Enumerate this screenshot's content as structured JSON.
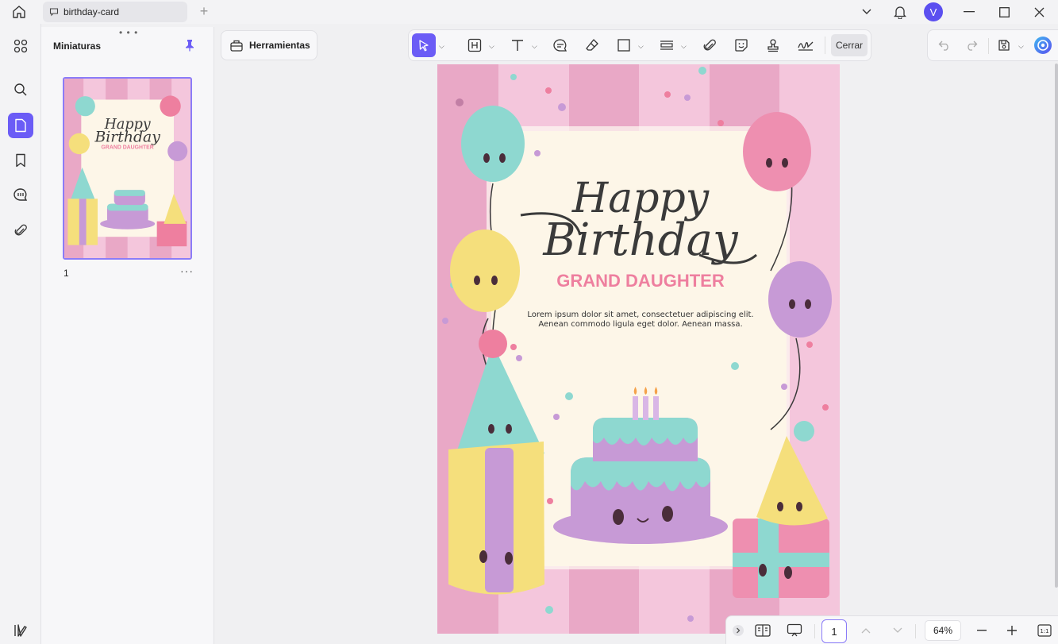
{
  "tab": {
    "title": "birthday-card"
  },
  "user": {
    "initial": "V"
  },
  "thumbnails": {
    "title": "Miniaturas",
    "page_label": "1",
    "more": "···",
    "grip": "• • •"
  },
  "tools": {
    "label": "Herramientas"
  },
  "toolbar": {
    "close_label": "Cerrar"
  },
  "document": {
    "title_line1": "Happy",
    "title_line2": "Birthday",
    "subtitle": "GRAND DAUGHTER",
    "body_line1": "Lorem ipsum dolor sit amet, consectetuer adipiscing elit.",
    "body_line2": "Aenean commodo ligula eget dolor. Aenean massa."
  },
  "footer": {
    "page_number": "1",
    "zoom": "64%"
  },
  "colors": {
    "accent": "#6b5cf6",
    "pink_stripe": "#e9a8c6",
    "light_stripe": "#f4c6dc",
    "card_bg": "#fdf6e8",
    "subtitle": "#ee7f9f",
    "teal": "#8ed8d0",
    "purple": "#c79ad6",
    "yellow": "#f5df7c"
  }
}
